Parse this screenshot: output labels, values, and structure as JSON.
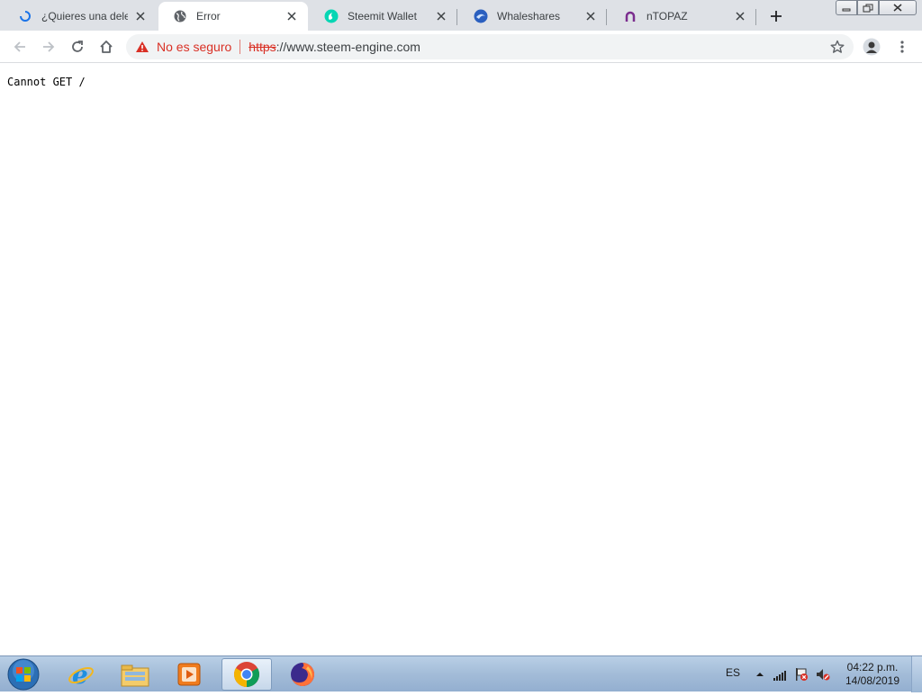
{
  "browser": {
    "tabs": [
      {
        "title": "¿Quieres una deleg",
        "favicon": "loading-spinner-icon",
        "active": false
      },
      {
        "title": "Error",
        "favicon": "globe-icon",
        "active": true
      },
      {
        "title": "Steemit Wallet",
        "favicon": "steemit-icon",
        "active": false
      },
      {
        "title": "Whaleshares",
        "favicon": "whaleshares-icon",
        "active": false
      },
      {
        "title": "nTOPAZ",
        "favicon": "ntopaz-icon",
        "active": false
      }
    ],
    "omnibox": {
      "security_label": "No es seguro",
      "url_scheme": "https",
      "url_rest": "://www.steem-engine.com"
    },
    "colors": {
      "warning": "#d93025",
      "tabstrip": "#dee1e6"
    }
  },
  "page": {
    "body_text": "Cannot GET /"
  },
  "taskbar": {
    "apps": [
      "internet-explorer-icon",
      "file-explorer-icon",
      "media-player-icon",
      "chrome-icon",
      "firefox-icon"
    ],
    "tray": {
      "language": "ES",
      "time": "04:22 p.m.",
      "date": "14/08/2019"
    }
  }
}
